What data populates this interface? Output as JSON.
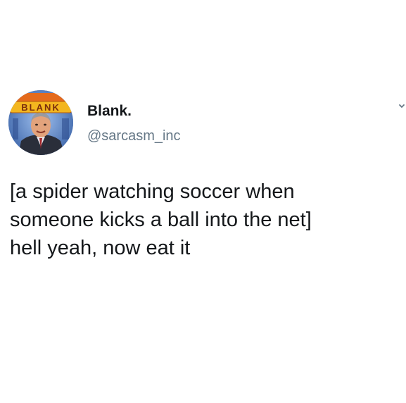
{
  "tweet": {
    "author": {
      "display_name": "Blank.",
      "handle": "@sarcasm_inc",
      "avatar_logo_text": "BLANK"
    },
    "text_lines": [
      "[a spider watching soccer when",
      "someone kicks a ball into the net]",
      "hell yeah, now eat it"
    ]
  },
  "icons": {
    "menu": "chevron-down-icon"
  },
  "colors": {
    "text": "#14171a",
    "handle": "#657786",
    "background": "#ffffff"
  }
}
